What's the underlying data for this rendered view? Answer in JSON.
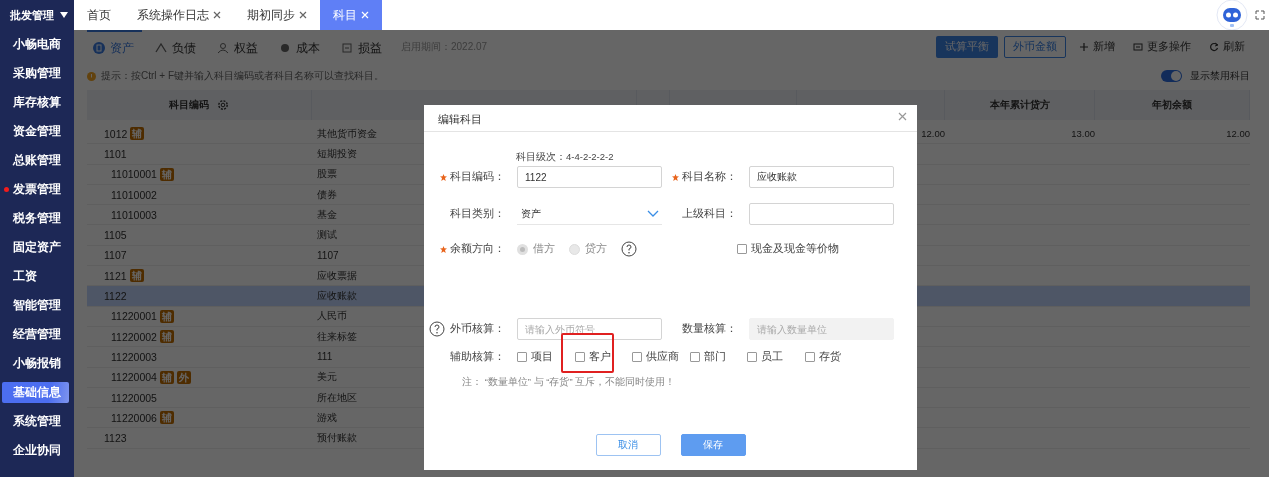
{
  "sidebar": {
    "header": {
      "label": "批发管理",
      "expanded": true
    },
    "items": [
      {
        "label": "小畅电商",
        "selected": false,
        "alert": false
      },
      {
        "label": "采购管理",
        "selected": false,
        "alert": false
      },
      {
        "label": "库存核算",
        "selected": false,
        "alert": false
      },
      {
        "label": "资金管理",
        "selected": false,
        "alert": false
      },
      {
        "label": "总账管理",
        "selected": false,
        "alert": false
      },
      {
        "label": "发票管理",
        "selected": false,
        "alert": true
      },
      {
        "label": "税务管理",
        "selected": false,
        "alert": false
      },
      {
        "label": "固定资产",
        "selected": false,
        "alert": false
      },
      {
        "label": "工资",
        "selected": false,
        "alert": false
      },
      {
        "label": "智能管理",
        "selected": false,
        "alert": false
      },
      {
        "label": "经营管理",
        "selected": false,
        "alert": false
      },
      {
        "label": "小畅报销",
        "selected": false,
        "alert": false
      },
      {
        "label": "基础信息",
        "selected": true,
        "alert": false
      },
      {
        "label": "系统管理",
        "selected": false,
        "alert": false
      },
      {
        "label": "企业协同",
        "selected": false,
        "alert": false
      }
    ]
  },
  "tabs": [
    {
      "label": "首页",
      "closable": false,
      "selected": false
    },
    {
      "label": "系统操作日志",
      "closable": true,
      "selected": false
    },
    {
      "label": "期初同步",
      "closable": true,
      "selected": false
    },
    {
      "label": "科目",
      "closable": true,
      "selected": true
    }
  ],
  "toolbar": {
    "categories": [
      {
        "label": "资产",
        "selected": true
      },
      {
        "label": "负债",
        "selected": false
      },
      {
        "label": "权益",
        "selected": false
      },
      {
        "label": "成本",
        "selected": false
      },
      {
        "label": "损益",
        "selected": false
      }
    ],
    "period": "启用期间：2022.07",
    "buttons": [
      {
        "label": "试算平衡",
        "kind": "primary"
      },
      {
        "label": "外币金额",
        "kind": "outline"
      },
      {
        "label": "新增",
        "kind": "add"
      },
      {
        "label": "更多操作",
        "kind": "more"
      },
      {
        "label": "刷新",
        "kind": "refresh"
      }
    ]
  },
  "hint": "提示：按Ctrl + F键并输入科目编码或者科目名称可以查找科目。",
  "show_disabled": {
    "label": "显示禁用科目",
    "on": true
  },
  "table": {
    "columns": [
      {
        "kind": "label",
        "label": "科目编码"
      },
      {
        "kind": "covered"
      },
      {
        "kind": "covered"
      },
      {
        "kind": "covered"
      },
      {
        "kind": "covered"
      },
      {
        "kind": "label",
        "label": "本年累计贷方"
      },
      {
        "kind": "label",
        "label": "年初余额"
      }
    ],
    "rows": [
      {
        "code": "1012",
        "badges": [
          "辅"
        ],
        "name": "其他货币资金",
        "selected": false,
        "cells": {
          "column_5": "12.00",
          "column_6": "13.00",
          "column_7": "12.00"
        }
      },
      {
        "code": "1101",
        "name": "短期投资",
        "selected": false,
        "children": [
          {
            "code": "11010001",
            "badges": [
              "辅"
            ],
            "name": "股票",
            "selected": false
          },
          {
            "code": "11010002",
            "name": "债券",
            "selected": false
          },
          {
            "code": "11010003",
            "name": "基金",
            "selected": false
          }
        ]
      },
      {
        "code": "1105",
        "name": "测试",
        "selected": false
      },
      {
        "code": "1107",
        "name": "1107",
        "selected": false
      },
      {
        "code": "1121",
        "badges": [
          "辅"
        ],
        "name": "应收票据",
        "selected": false
      },
      {
        "code": "1122",
        "name": "应收账款",
        "selected": true,
        "children": [
          {
            "code": "11220001",
            "badges": [
              "辅"
            ],
            "name": "人民币",
            "selected": false
          },
          {
            "code": "11220002",
            "badges": [
              "辅"
            ],
            "name": "往来标签",
            "selected": false
          },
          {
            "code": "11220003",
            "name": "111",
            "selected": false
          },
          {
            "code": "11220004",
            "badges": [
              "辅",
              "外"
            ],
            "name": "美元",
            "selected": false
          },
          {
            "code": "11220005",
            "name": "所在地区",
            "selected": false
          },
          {
            "code": "11220006",
            "badges": [
              "辅"
            ],
            "name": "游戏",
            "selected": false
          }
        ]
      },
      {
        "code": "1123",
        "name": "预付账款",
        "selected": false
      }
    ]
  },
  "dialog": {
    "title": "编辑科目",
    "level_hint": "科目级次：4-4-2-2-2-2",
    "code": {
      "label": "科目编码：",
      "required": true,
      "value": "1122"
    },
    "name": {
      "label": "科目名称：",
      "required": true,
      "value": "应收账款"
    },
    "category": {
      "label": "科目类别：",
      "required": false,
      "value": "资产"
    },
    "parent": {
      "label": "上级科目：",
      "required": false
    },
    "direction": {
      "label": "余额方向：",
      "required": true,
      "disabled": true,
      "options": [
        {
          "label": "借方",
          "selected": true
        },
        {
          "label": "贷方",
          "selected": false
        }
      ]
    },
    "cash_equivalent": {
      "label": "现金及现金等价物",
      "checked": false
    },
    "currency": {
      "label": "外币核算：",
      "placeholder": "请输入外币符号"
    },
    "quantity": {
      "label": "数量核算：",
      "placeholder": "请输入数量单位",
      "disabled": true
    },
    "auxiliary": {
      "label": "辅助核算：",
      "options": [
        {
          "label": "项目",
          "checked": false,
          "highlighted": false
        },
        {
          "label": "客户",
          "checked": false,
          "highlighted": true
        },
        {
          "label": "供应商",
          "checked": false,
          "highlighted": false
        },
        {
          "label": "部门",
          "checked": false,
          "highlighted": false
        },
        {
          "label": "员工",
          "checked": false,
          "highlighted": false
        },
        {
          "label": "存货",
          "checked": false,
          "highlighted": false
        }
      ]
    },
    "note": "注：  “数量单位” 与 “存货” 互斥，不能同时使用！",
    "buttons": [
      {
        "label": "取消",
        "kind": "secondary"
      },
      {
        "label": "保存",
        "kind": "primary"
      }
    ]
  }
}
